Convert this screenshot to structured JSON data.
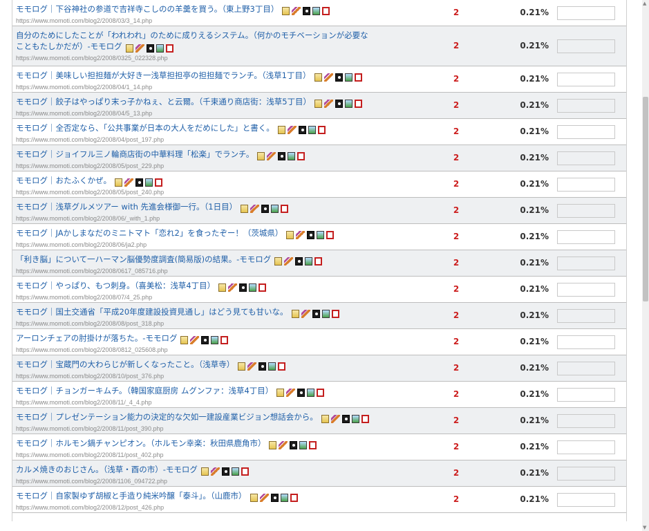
{
  "colors": {
    "link": "#1f5fa8",
    "url": "#8a8a8a",
    "count": "#cc1f1f",
    "row_alt": "#eef0f2"
  },
  "icon_names": [
    "hatena-bookmark-icon",
    "pen-icon",
    "camera-icon",
    "photo-icon",
    "book-icon"
  ],
  "rows": [
    {
      "title": "モモログ｜下谷神社の参道で吉祥寺こしのの羊羹を買う。（東上野3丁目）",
      "url": "https://www.momoti.com/blog2/2008/03/3_14.php",
      "count": "2",
      "percent": "0.21%"
    },
    {
      "title": "自分のためにしたことが「われわれ」のために成りえるシステム。（何かのモチベーションが必要なこともたしかだが）-モモログ",
      "url": "https://www.momoti.com/blog2/2008/0325_022328.php",
      "count": "2",
      "percent": "0.21%",
      "tall": true
    },
    {
      "title": "モモログ｜美味しい担担麺が大好き一浅草担担亭の担担麺でランチ。（浅草1丁目）",
      "url": "https://www.momoti.com/blog2/2008/04/1_14.php",
      "count": "2",
      "percent": "0.21%"
    },
    {
      "title": "モモログ｜餃子はやっぱり末っ子かねぇ、と云爾。（千束通り商店街：浅草5丁目）",
      "url": "https://www.momoti.com/blog2/2008/04/5_13.php",
      "count": "2",
      "percent": "0.21%"
    },
    {
      "title": "モモログ｜全否定なら、「公共事業が日本の大人をだめにした」と書く。",
      "url": "https://www.momoti.com/blog2/2008/04/post_197.php",
      "count": "2",
      "percent": "0.21%"
    },
    {
      "title": "モモログ｜ジョイフル三ノ輪商店街の中華料理「松楽」でランチ。",
      "url": "https://www.momoti.com/blog2/2008/05/post_229.php",
      "count": "2",
      "percent": "0.21%"
    },
    {
      "title": "モモログ｜おたふくかぜ。",
      "url": "https://www.momoti.com/blog2/2008/05/post_240.php",
      "count": "2",
      "percent": "0.21%"
    },
    {
      "title": "モモログ｜浅草グルメツアー with 先進会様御一行。（1日目）",
      "url": "https://www.momoti.com/blog2/2008/06/_with_1.php",
      "count": "2",
      "percent": "0.21%"
    },
    {
      "title": "モモログ｜JAかしまなだのミニトマト「恋れ2」を食ったぞー！（茨城県）",
      "url": "https://www.momoti.com/blog2/2008/06/ja2.php",
      "count": "2",
      "percent": "0.21%"
    },
    {
      "title": "「利き脳」について一ハーマン脳優勢度調査(簡易版)の結果。-モモログ",
      "url": "https://www.momoti.com/blog2/2008/0617_085716.php",
      "count": "2",
      "percent": "0.21%"
    },
    {
      "title": "モモログ｜やっぱり、もつ刺身。（喜美松：浅草4丁目）",
      "url": "https://www.momoti.com/blog2/2008/07/4_25.php",
      "count": "2",
      "percent": "0.21%"
    },
    {
      "title": "モモログ｜国土交通省「平成20年度建設投資見通し」はどう見ても甘いな。",
      "url": "https://www.momoti.com/blog2/2008/08/post_318.php",
      "count": "2",
      "percent": "0.21%"
    },
    {
      "title": "アーロンチェアの肘掛けが落ちた。-モモログ",
      "url": "https://www.momoti.com/blog2/2008/0812_025608.php",
      "count": "2",
      "percent": "0.21%"
    },
    {
      "title": "モモログ｜宝蔵門の大わらじが新しくなったこと。（浅草寺）",
      "url": "https://www.momoti.com/blog2/2008/10/post_376.php",
      "count": "2",
      "percent": "0.21%"
    },
    {
      "title": "モモログ｜チョンガーキムチ。（韓国家庭厨房 ムグンファ：浅草4丁目）",
      "url": "https://www.momoti.com/blog2/2008/11/_4_4.php",
      "count": "2",
      "percent": "0.21%"
    },
    {
      "title": "モモログ｜プレゼンテーション能力の決定的な欠如一建設産業ビジョン想話会から。",
      "url": "https://www.momoti.com/blog2/2008/11/post_390.php",
      "count": "2",
      "percent": "0.21%"
    },
    {
      "title": "モモログ｜ホルモン鍋チャンピオン。（ホルモン幸楽：秋田県鹿角市）",
      "url": "https://www.momoti.com/blog2/2008/11/post_402.php",
      "count": "2",
      "percent": "0.21%"
    },
    {
      "title": "カルメ焼きのおじさん。（浅草・酉の市）-モモログ",
      "url": "https://www.momoti.com/blog2/2008/1106_094722.php",
      "count": "2",
      "percent": "0.21%"
    },
    {
      "title": "モモログ｜自家製ゆず胡椒と手造り純米吟醸「泰斗」。（山鹿市）",
      "url": "https://www.momoti.com/blog2/2008/12/post_426.php",
      "count": "2",
      "percent": "0.21%"
    }
  ]
}
